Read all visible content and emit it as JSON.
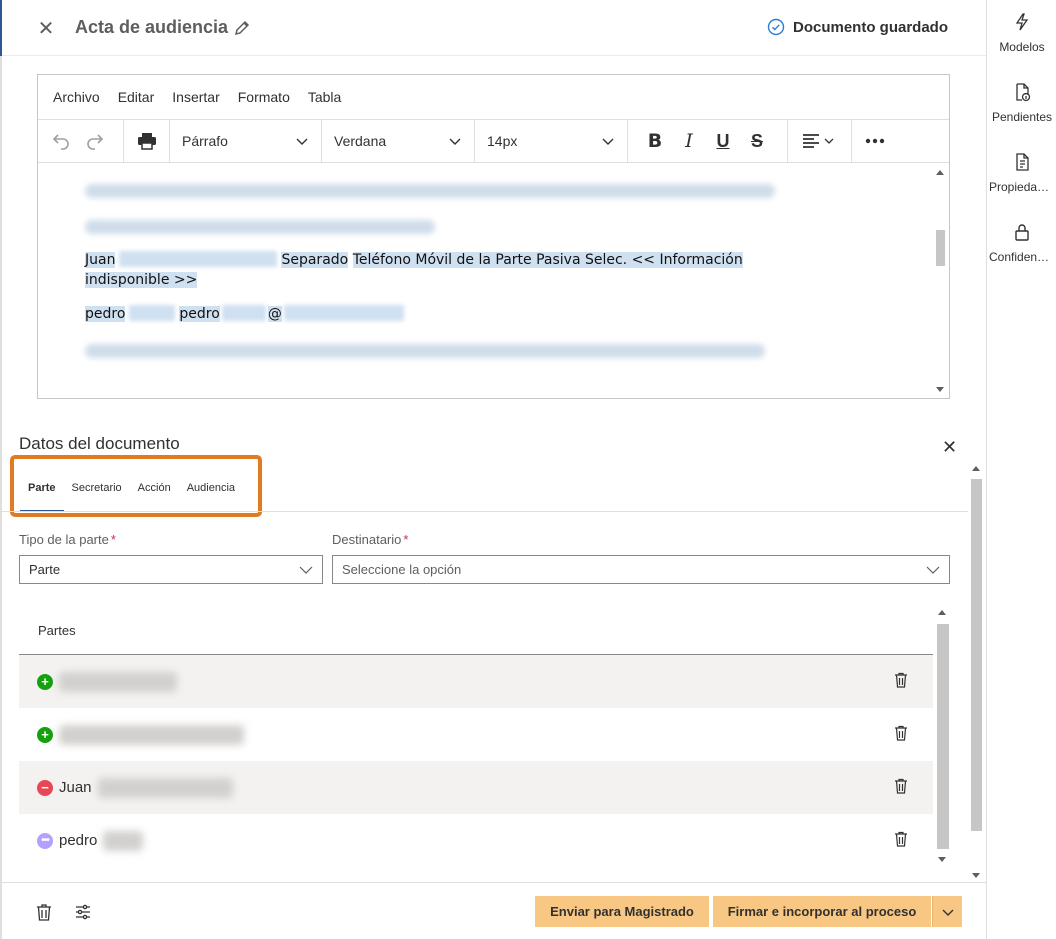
{
  "header": {
    "title": "Acta de audiencia",
    "status": "Documento guardado"
  },
  "editor": {
    "menu": [
      "Archivo",
      "Editar",
      "Insertar",
      "Formato",
      "Tabla"
    ],
    "block_format": "Párrafo",
    "font_family": "Verdana",
    "font_size": "14px",
    "content": {
      "line1_name": "Juan",
      "line1_text": "Separado",
      "line1_rest": "Teléfono Móvil de la Parte Pasiva Selec. << Información",
      "line1_cont": "indisponible >>",
      "line2_a": "pedro",
      "line2_b": "pedro",
      "line2_at": "@"
    }
  },
  "panel": {
    "title": "Datos del documento",
    "tabs": [
      "Parte",
      "Secretario",
      "Acción",
      "Audiencia"
    ],
    "active_tab": "Parte",
    "tipo_label": "Tipo de la parte",
    "tipo_value": "Parte",
    "dest_label": "Destinatario",
    "dest_placeholder": "Seleccione la opción",
    "list_header": "Partes",
    "rows": [
      {
        "status": "add",
        "name": ""
      },
      {
        "status": "add",
        "name": ""
      },
      {
        "status": "remove",
        "name": "Juan"
      },
      {
        "status": "pending",
        "name": "pedro"
      }
    ]
  },
  "footer": {
    "send_label": "Enviar para Magistrado",
    "sign_label": "Firmar e incorporar al proceso"
  },
  "rail": {
    "items": [
      "Modelos",
      "Pendientes",
      "Propiedades",
      "Confidencialidad"
    ]
  },
  "colors": {
    "accent": "#2b5797",
    "button": "#f9c784",
    "highlight": "#e07b22",
    "add": "#13a10e",
    "remove": "#e74856",
    "pending": "#b4a0ff"
  }
}
